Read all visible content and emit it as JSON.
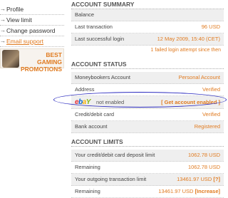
{
  "sidebar": {
    "items": [
      {
        "label": "Profile",
        "active": false
      },
      {
        "label": "View limit",
        "active": false
      },
      {
        "label": "Change password",
        "active": false
      },
      {
        "label": "Email support",
        "active": true
      }
    ],
    "promo": {
      "line1": "BEST GAMING",
      "line2": "PROMOTIONS"
    }
  },
  "summary": {
    "title": "ACCOUNT SUMMARY",
    "balance_label": "Balance",
    "last_tx_label": "Last transaction",
    "last_tx_value": "96 USD",
    "last_login_label": "Last successful login",
    "last_login_value": "12 May 2009, 15:40 (CET)",
    "failed_note": "1 failed login attempt since then"
  },
  "status": {
    "title": "ACCOUNT STATUS",
    "moneybookers_label": "Moneybookers Account",
    "moneybookers_value": "Personal Account",
    "address_label": "Address",
    "address_value": "Verified",
    "ebay_logo": {
      "e": "e",
      "b": "b",
      "a": "a",
      "y": "Y"
    },
    "ebay_status": "not enabled",
    "ebay_action": "[ Get account enabled ]",
    "card_label": "Credit/debit card",
    "card_value": "Verified",
    "bank_label": "Bank account",
    "bank_value": "Registered"
  },
  "limits": {
    "title": "ACCOUNT LIMITS",
    "deposit_label": "Your credit/debit card deposit limit",
    "deposit_value": "1062.78 USD",
    "remaining1_label": "Remaining",
    "remaining1_value": "1062.78 USD",
    "outgoing_label": "Your outgoing transaction limit",
    "outgoing_value": "13461.97 USD",
    "outgoing_help": "[?]",
    "remaining2_label": "Remaining",
    "remaining2_value": "13461.97 USD",
    "increase_label": "[Increase]"
  },
  "colors": {
    "accent": "#e07a1f",
    "highlight_ring": "#2a2abf"
  }
}
